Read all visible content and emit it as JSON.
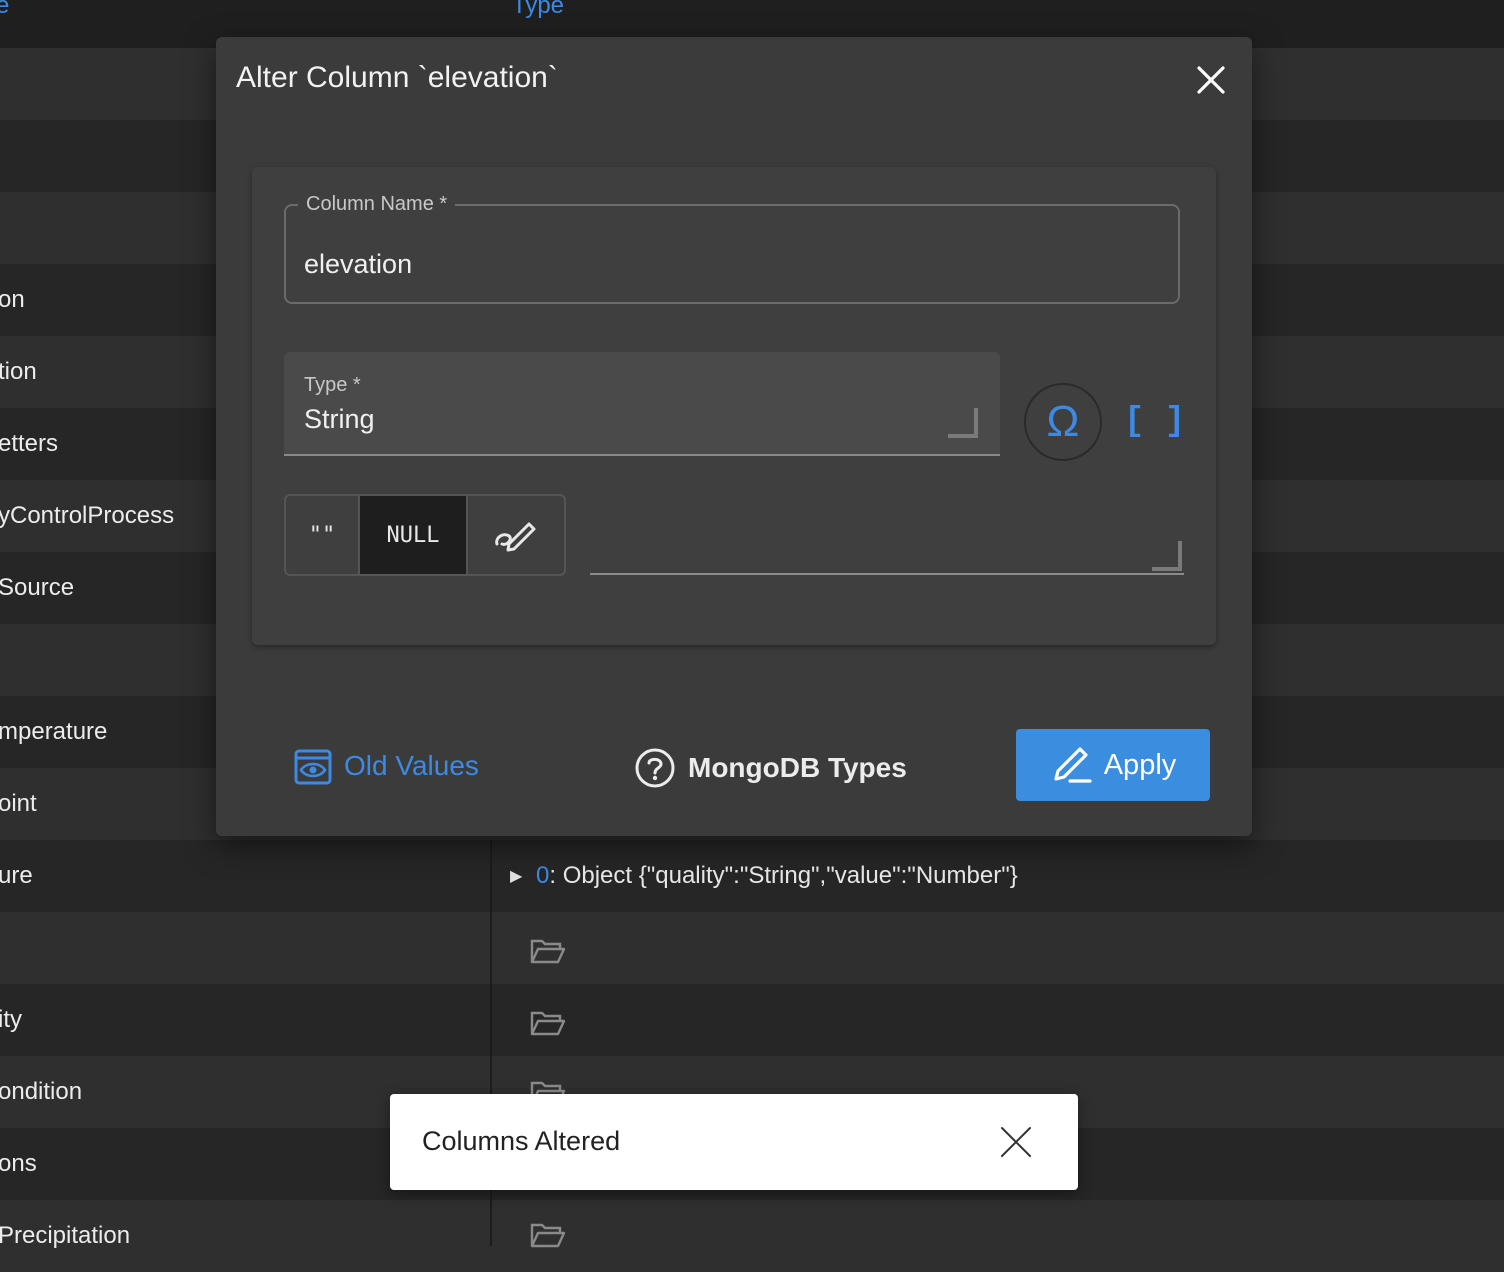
{
  "background_table": {
    "headers": [
      "e",
      "Type"
    ],
    "rows": [
      "",
      "",
      "",
      "on",
      "tion",
      "etters",
      "yControlProcess",
      "Source",
      "",
      "mperature",
      "oint",
      "ure",
      "",
      "ity",
      "ondition",
      "ons",
      "Precipitation"
    ],
    "object_row": {
      "index": "0",
      "text": ": Object {\"quality\":\"String\",\"value\":\"Number\"}"
    }
  },
  "modal": {
    "title": "Alter Column `elevation`",
    "column_name": {
      "label": "Column Name *",
      "value": "elevation"
    },
    "type": {
      "label": "Type *",
      "value": "String"
    },
    "omega_label": "Ω",
    "array_label": "[ ]",
    "toggles": [
      "\"\"",
      "NULL"
    ],
    "default_value": "",
    "old_values_label": "Old Values",
    "mongo_types_label": "MongoDB Types",
    "apply_label": "Apply"
  },
  "toast": {
    "message": "Columns Altered"
  },
  "colors": {
    "accent": "#3d8ae5",
    "apply": "#3b8de0",
    "modal_bg": "#3b3b3b"
  }
}
